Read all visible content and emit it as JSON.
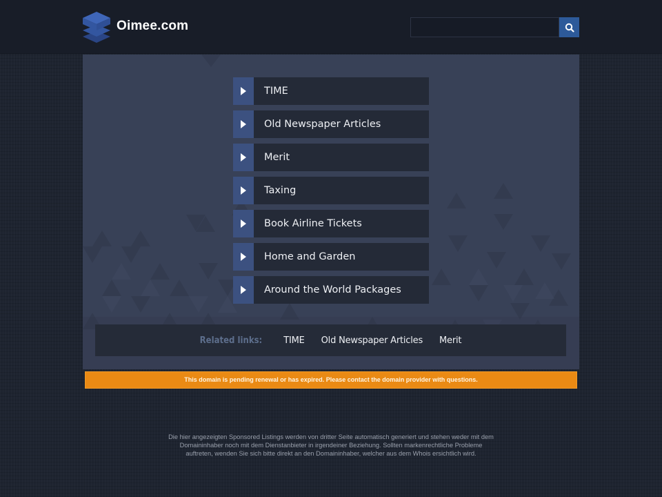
{
  "header": {
    "site_name": "Oimee.com",
    "logo_icon": "stacked-layers-icon",
    "search": {
      "value": "",
      "placeholder": "",
      "button_icon": "search-icon",
      "button_color": "#2d5a9a"
    }
  },
  "links": [
    {
      "label": "TIME",
      "icon": "play-arrow-icon"
    },
    {
      "label": "Old Newspaper Articles",
      "icon": "play-arrow-icon"
    },
    {
      "label": "Merit",
      "icon": "play-arrow-icon"
    },
    {
      "label": "Taxing",
      "icon": "play-arrow-icon"
    },
    {
      "label": "Book Airline Tickets",
      "icon": "play-arrow-icon"
    },
    {
      "label": "Home and Garden",
      "icon": "play-arrow-icon"
    },
    {
      "label": "Around the World Packages",
      "icon": "play-arrow-icon"
    }
  ],
  "related": {
    "title": "Related links:",
    "links": [
      "TIME",
      "Old Newspaper Articles",
      "Merit"
    ]
  },
  "alert": {
    "text": "This domain is pending renewal or has expired. Please contact the domain provider with questions.",
    "color": "#ea8a14"
  },
  "disclaimer": {
    "text": "Die hier angezeigten Sponsored Listings werden von dritter Seite automatisch generiert und stehen weder mit dem Domaininhaber noch mit dem Dienstanbieter in irgendeiner Beziehung. Sollten markenrechtliche Probleme auftreten, wenden Sie sich bitte direkt an den Domaininhaber, welcher aus dem Whois ersichtlich wird."
  },
  "colors": {
    "header_bg": "#181d28",
    "panel_bg": "#384157",
    "item_bg": "#242a37",
    "arrow_bg": "#3c5180",
    "related_title": "#5d6e8c"
  }
}
